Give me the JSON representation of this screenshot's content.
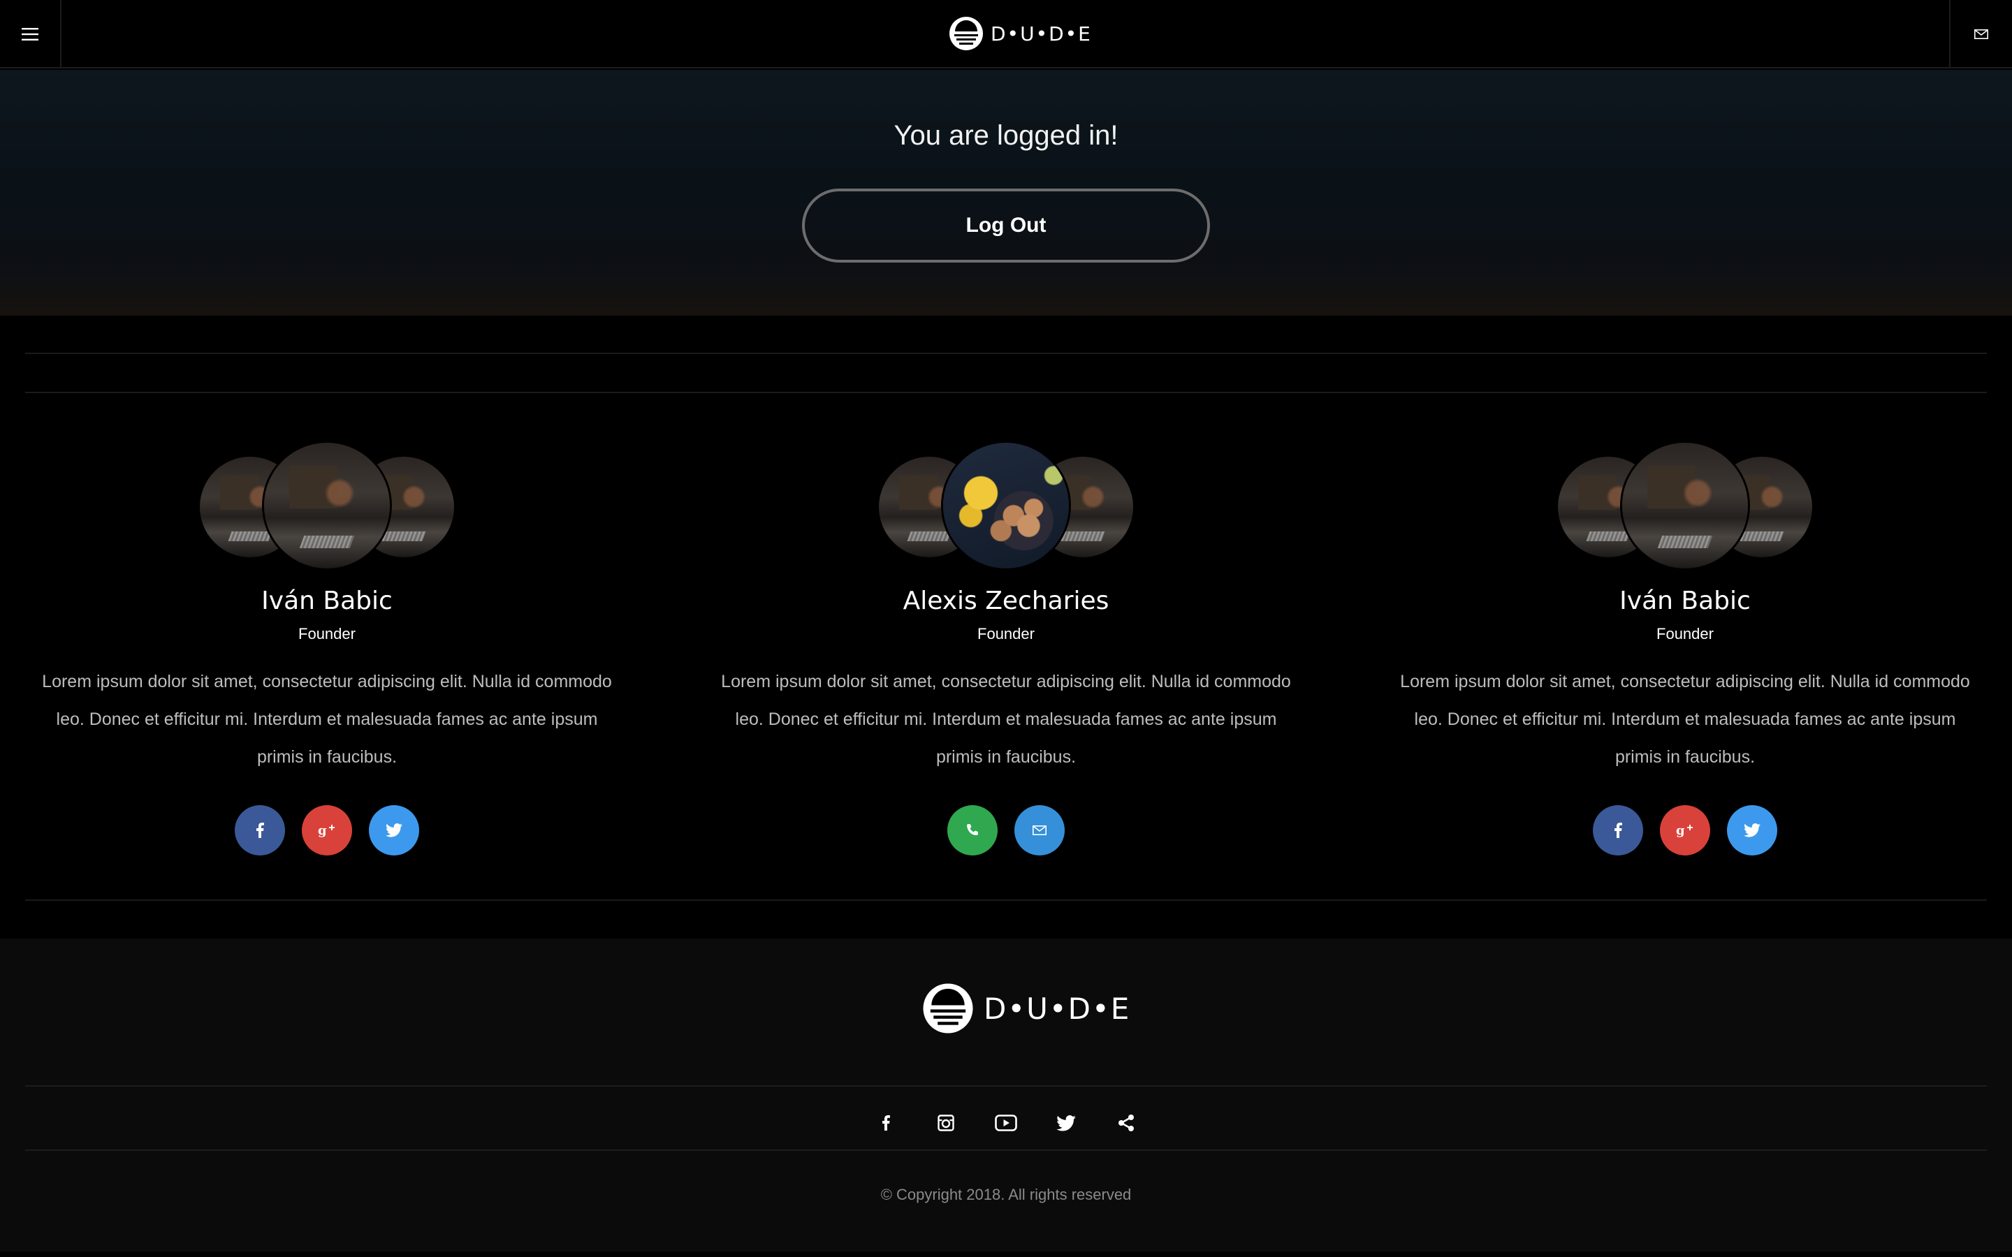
{
  "header": {
    "brand": "D•U•D•E",
    "menu_icon": "menu-icon",
    "mail_icon": "mail-icon"
  },
  "hero": {
    "title": "You are logged in!",
    "logout_label": "Log Out"
  },
  "team": [
    {
      "name": "Iván Babic",
      "role": "Founder",
      "bio": "Lorem ipsum dolor sit amet, consectetur adipiscing elit. Nulla id commodo leo. Donec et efficitur mi. Interdum et malesuada fames ac ante ipsum primis in faucibus.",
      "socials": [
        "facebook-icon",
        "google-plus-icon",
        "twitter-icon"
      ]
    },
    {
      "name": "Alexis Zecharies",
      "role": "Founder",
      "bio": "Lorem ipsum dolor sit amet, consectetur adipiscing elit. Nulla id commodo leo. Donec et efficitur mi. Interdum et malesuada fames ac ante ipsum primis in faucibus.",
      "socials": [
        "phone-icon",
        "mail-icon"
      ]
    },
    {
      "name": "Iván Babic",
      "role": "Founder",
      "bio": "Lorem ipsum dolor sit amet, consectetur adipiscing elit. Nulla id commodo leo. Donec et efficitur mi. Interdum et malesuada fames ac ante ipsum primis in faucibus.",
      "socials": [
        "facebook-icon",
        "google-plus-icon",
        "twitter-icon"
      ]
    }
  ],
  "footer": {
    "brand": "D•U•D•E",
    "socials": [
      "facebook-icon",
      "instagram-icon",
      "youtube-icon",
      "twitter-icon",
      "share-icon"
    ],
    "copyright": "© Copyright 2018. All rights reserved"
  },
  "colors": {
    "facebook": "#3b5998",
    "google_plus": "#d9423a",
    "twitter": "#3d99ee",
    "phone": "#2fa84f",
    "mail": "#3590d9"
  }
}
